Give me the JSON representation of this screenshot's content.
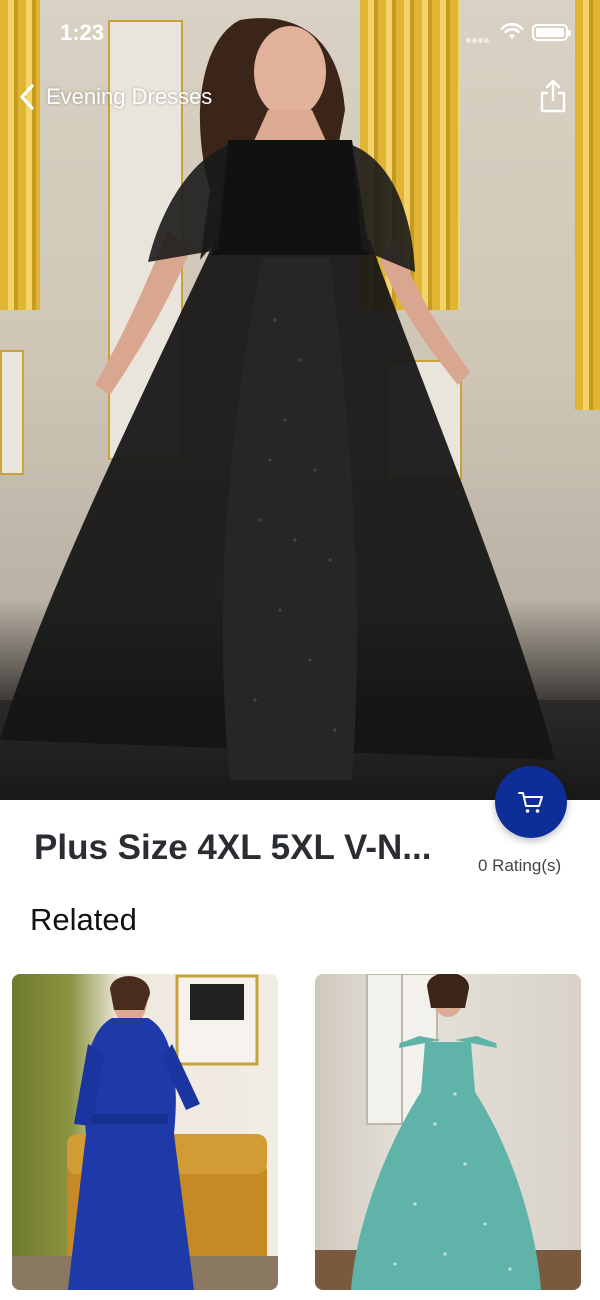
{
  "status_bar": {
    "time": "1:23"
  },
  "nav": {
    "title": "Evening Dresses"
  },
  "product": {
    "title": "Plus Size 4XL 5XL V-N...",
    "rating": "0 Rating(s)",
    "image_icon": "dress-photo"
  },
  "related": {
    "heading": "Related",
    "items": [
      {
        "image_icon": "royal-blue-sequin-dress-photo",
        "color": "#1d3aa8"
      },
      {
        "image_icon": "teal-glitter-offshoulder-dress-photo",
        "color": "#5fb3a8"
      }
    ]
  },
  "colors": {
    "cart_button": "#0c2e96",
    "background": "#ffffff"
  }
}
